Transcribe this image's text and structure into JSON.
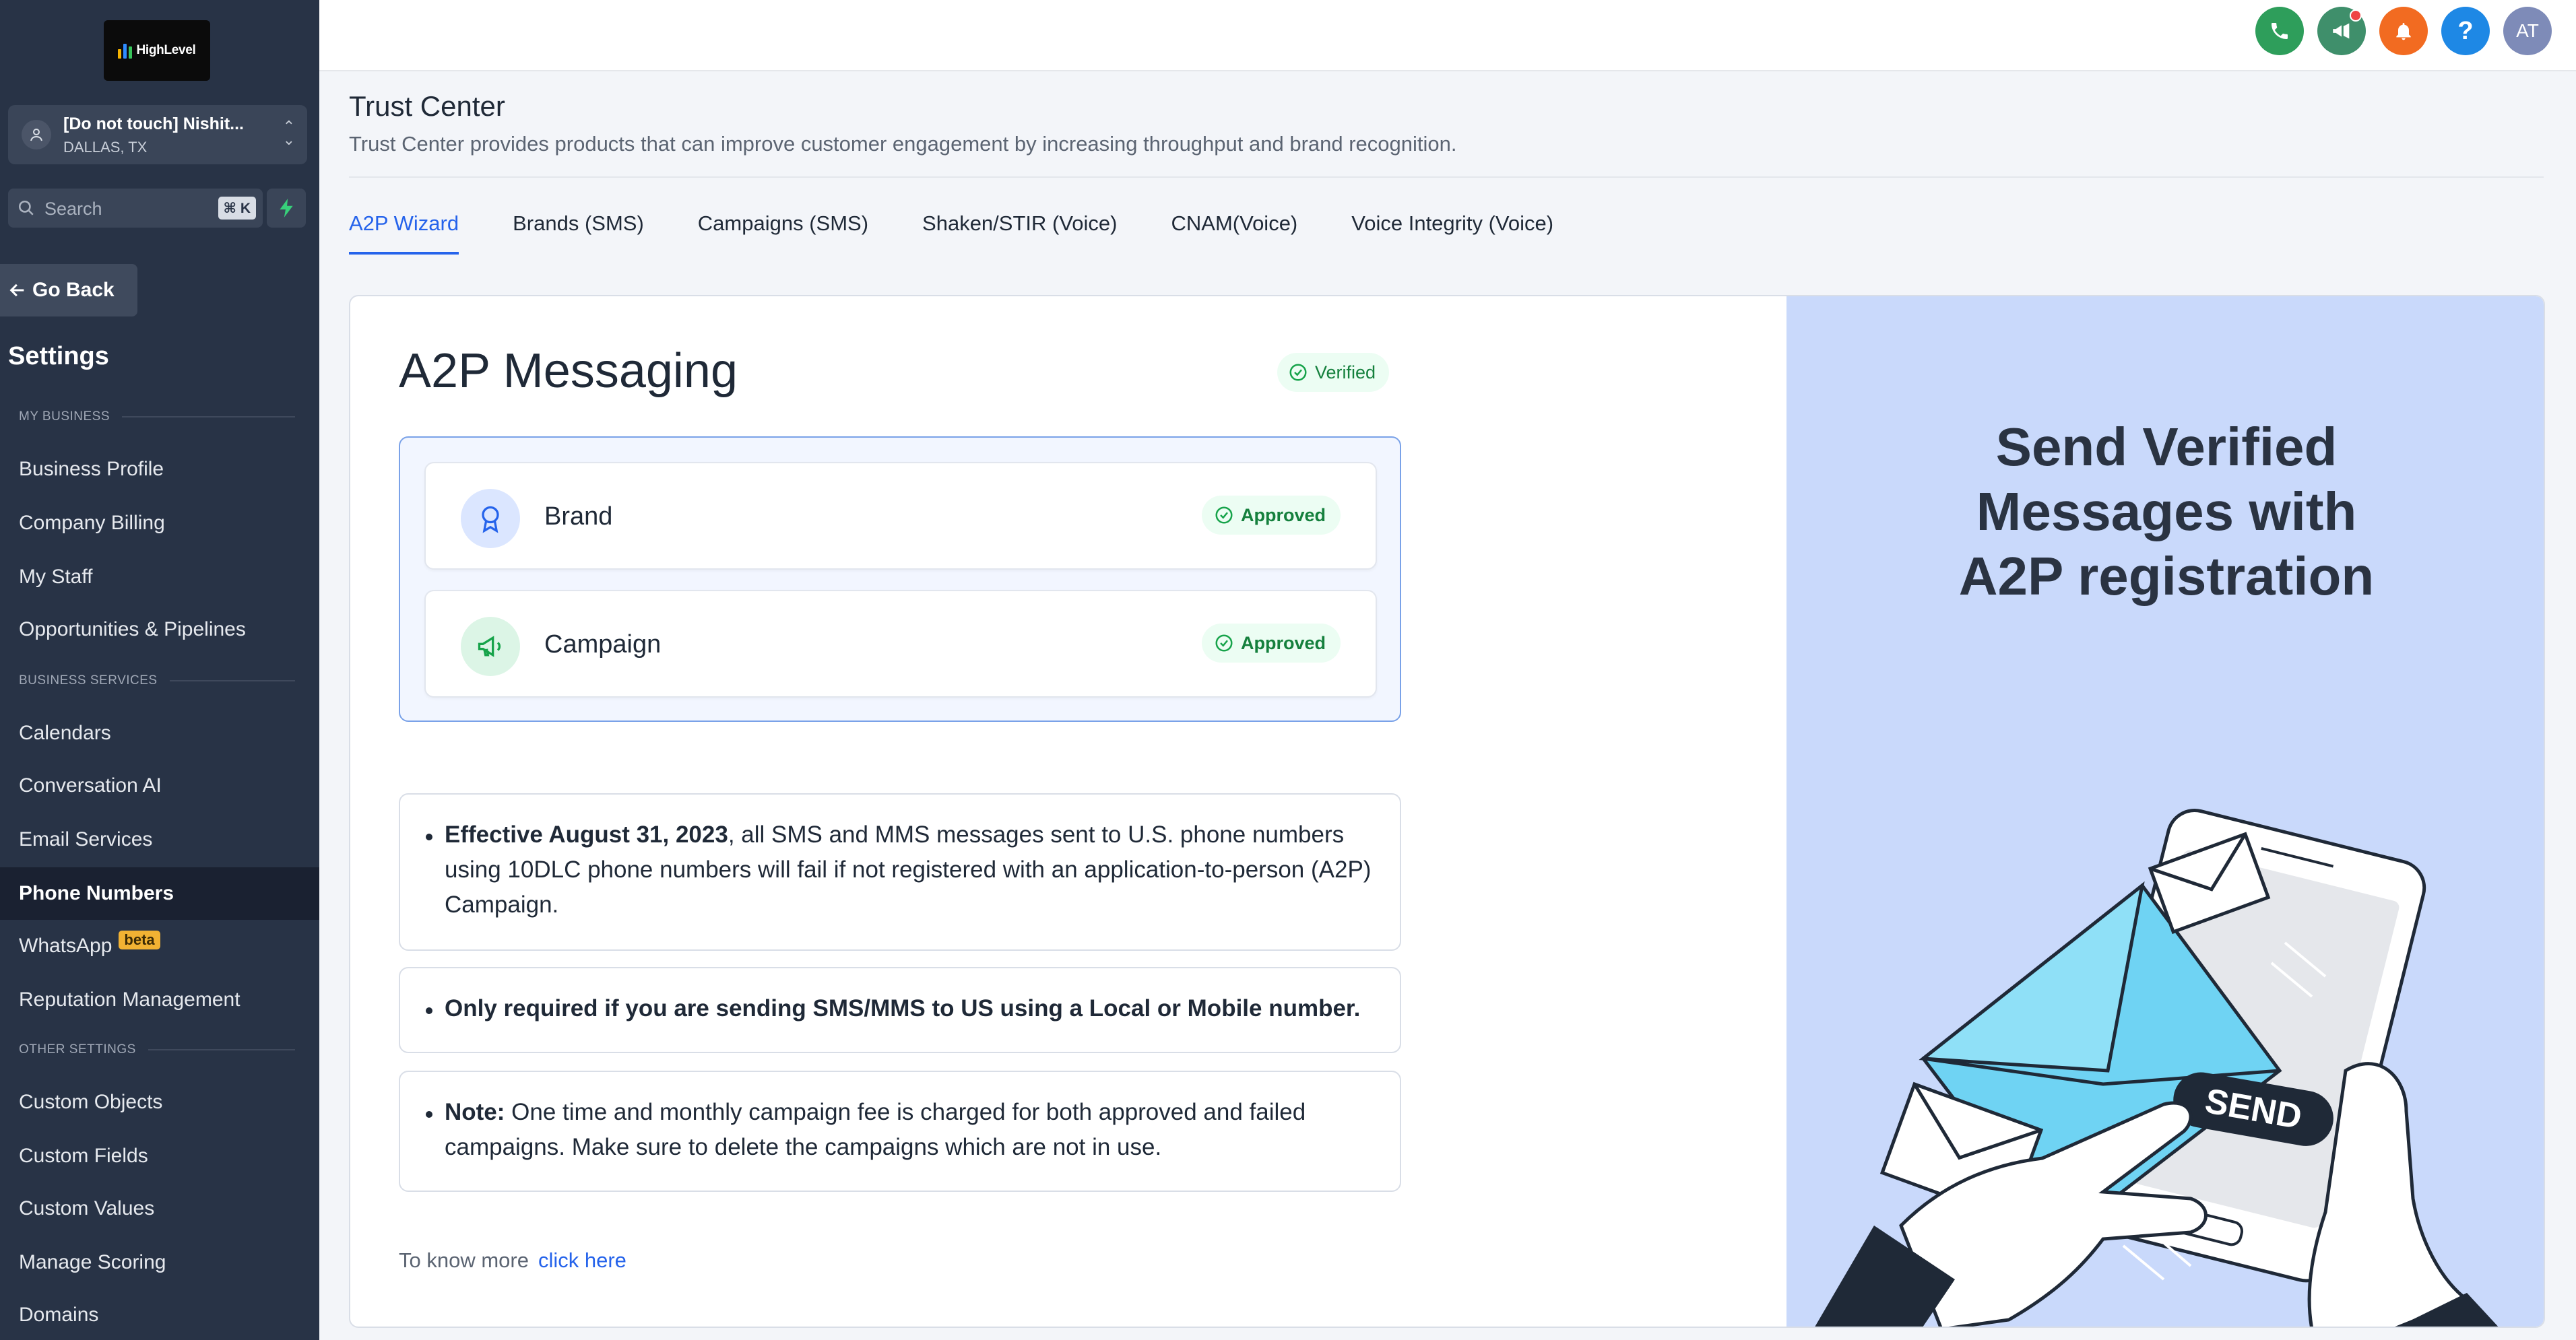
{
  "sidebar": {
    "logo": "HighLevel",
    "account": {
      "name": "[Do not touch] Nishit...",
      "location": "DALLAS, TX"
    },
    "search": {
      "placeholder": "Search",
      "shortcut": "⌘ K"
    },
    "go_back": "Go Back",
    "settings_title": "Settings",
    "sections": {
      "my_business": "MY BUSINESS",
      "business_services": "BUSINESS SERVICES",
      "other_settings": "OTHER SETTINGS"
    },
    "items": {
      "business_profile": "Business Profile",
      "company_billing": "Company Billing",
      "my_staff": "My Staff",
      "opportunities": "Opportunities & Pipelines",
      "calendars": "Calendars",
      "conversation_ai": "Conversation AI",
      "email_services": "Email Services",
      "phone_numbers": "Phone Numbers",
      "whatsapp": "WhatsApp",
      "whatsapp_badge": "beta",
      "reputation": "Reputation Management",
      "custom_objects": "Custom Objects",
      "custom_fields": "Custom Fields",
      "custom_values": "Custom Values",
      "manage_scoring": "Manage Scoring",
      "domains": "Domains"
    }
  },
  "topbar": {
    "avatar_initials": "AT",
    "colors": {
      "phone": "#2e9e5b",
      "announce": "#3f8f6b",
      "bell": "#f26b21",
      "help": "#1e88e5",
      "avatar": "#7e8bb8"
    }
  },
  "header": {
    "title": "Trust Center",
    "subtitle": "Trust Center provides products that can improve customer engagement by increasing throughput and brand recognition."
  },
  "tabs": [
    "A2P Wizard",
    "Brands (SMS)",
    "Campaigns (SMS)",
    "Shaken/STIR (Voice)",
    "CNAM(Voice)",
    "Voice Integrity (Voice)"
  ],
  "a2p": {
    "title": "A2P Messaging",
    "status": "Verified",
    "steps": [
      {
        "label": "Brand",
        "status": "Approved"
      },
      {
        "label": "Campaign",
        "status": "Approved"
      }
    ],
    "notices": {
      "n1_bold": "Effective August 31, 2023",
      "n1_text": ", all SMS and MMS messages sent to U.S. phone numbers using 10DLC phone numbers will fail if not registered with an application-to-person (A2P) Campaign.",
      "n2_bold": "Only required if you are sending SMS/MMS to US using a Local or Mobile number.",
      "n3_bold": "Note:",
      "n3_text": " One time and monthly campaign fee is charged for both approved and failed campaigns. Make sure to delete the campaigns which are not in use."
    },
    "more_text": "To know more",
    "more_link": "click here"
  },
  "promo": {
    "title_line1": "Send Verified",
    "title_line2": "Messages with",
    "title_line3": "A2P registration",
    "send_label": "SEND"
  }
}
